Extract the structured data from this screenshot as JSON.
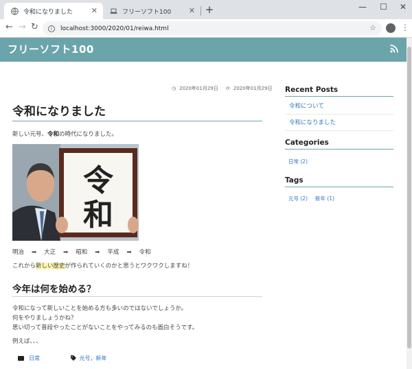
{
  "browser": {
    "tabs": [
      {
        "title": "令和になりました",
        "active": true
      },
      {
        "title": "フリーソフト100",
        "active": false
      }
    ],
    "new_tab": "+",
    "window_controls": {
      "minimize": "—",
      "maximize": "☐",
      "close": "✕"
    },
    "url": "localhost:3000/2020/01/reiwa.html"
  },
  "site": {
    "title": "フリーソフト100",
    "header_color": "#6ba5ab",
    "rss_icon": "rss-icon"
  },
  "post": {
    "published": "2020年01月29日",
    "updated": "2020年01月29日",
    "title": "令和になりました",
    "intro_before": "新しい元号、",
    "intro_bold": "令和",
    "intro_after": "の時代になりました。",
    "photo_text": "令和",
    "eras": [
      "明治",
      "大正",
      "昭和",
      "平成",
      "令和"
    ],
    "arrow": "➡",
    "line2_before": "これから",
    "line2_highlight": "新しい歴史",
    "line2_after": "が作られていくのかと思うとワクワクしますね！",
    "section_title": "今年は何を始める？",
    "section_lines": [
      "令和になって新しいことを始める方も多いのではないでしょうか。",
      "何をやりましょうかね？",
      "思い切って普段やったことがないことをやってみるのも面白そうです。"
    ],
    "closing": "例えば、、、",
    "category": "日常",
    "tags_text": "元号，新年"
  },
  "sidebar": {
    "recent_heading": "Recent Posts",
    "recent": [
      "令和について",
      "令和になりました"
    ],
    "categories_heading": "Categories",
    "categories": [
      "日常 (2)"
    ],
    "tags_heading": "Tags",
    "tags": [
      "元号 (2)",
      "新年 (1)"
    ]
  }
}
